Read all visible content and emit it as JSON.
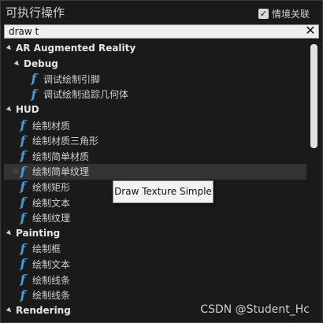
{
  "header": {
    "title": "可执行操作",
    "context_label": "情境关联",
    "context_checked": true
  },
  "search": {
    "value": "draw t",
    "clear_icon": "close-icon"
  },
  "tree": [
    {
      "kind": "category",
      "label": "AR Augmented Reality",
      "level": 0
    },
    {
      "kind": "category",
      "label": "Debug",
      "level": 1
    },
    {
      "kind": "item",
      "label": "调试绘制引脚",
      "level": 2,
      "icon": "function-icon"
    },
    {
      "kind": "item",
      "label": "调试绘制追踪几何体",
      "level": 2,
      "icon": "function-icon"
    },
    {
      "kind": "category",
      "label": "HUD",
      "level": 0
    },
    {
      "kind": "item",
      "label": "绘制材质",
      "level": 1,
      "icon": "function-icon"
    },
    {
      "kind": "item",
      "label": "绘制材质三角形",
      "level": 1,
      "icon": "function-icon"
    },
    {
      "kind": "item",
      "label": "绘制简单材质",
      "level": 1,
      "icon": "function-icon"
    },
    {
      "kind": "item",
      "label": "绘制简单纹理",
      "level": 1,
      "icon": "function-icon",
      "hovered": true
    },
    {
      "kind": "item",
      "label": "绘制矩形",
      "level": 1,
      "icon": "function-icon"
    },
    {
      "kind": "item",
      "label": "绘制文本",
      "level": 1,
      "icon": "function-icon"
    },
    {
      "kind": "item",
      "label": "绘制纹理",
      "level": 1,
      "icon": "function-icon"
    },
    {
      "kind": "category",
      "label": "Painting",
      "level": 0
    },
    {
      "kind": "item",
      "label": "绘制框",
      "level": 1,
      "icon": "function-icon"
    },
    {
      "kind": "item",
      "label": "绘制文本",
      "level": 1,
      "icon": "function-icon"
    },
    {
      "kind": "item",
      "label": "绘制线条",
      "level": 1,
      "icon": "function-icon"
    },
    {
      "kind": "item",
      "label": "绘制线条",
      "level": 1,
      "icon": "function-icon"
    },
    {
      "kind": "category",
      "label": "Rendering",
      "level": 0
    }
  ],
  "tooltip": {
    "text": "Draw Texture Simple"
  },
  "watermark": {
    "text": "CSDN @Student_Hc"
  },
  "colors": {
    "function_icon": "#3f9fe0",
    "background": "#1a1a1a",
    "hover": "#333333"
  }
}
